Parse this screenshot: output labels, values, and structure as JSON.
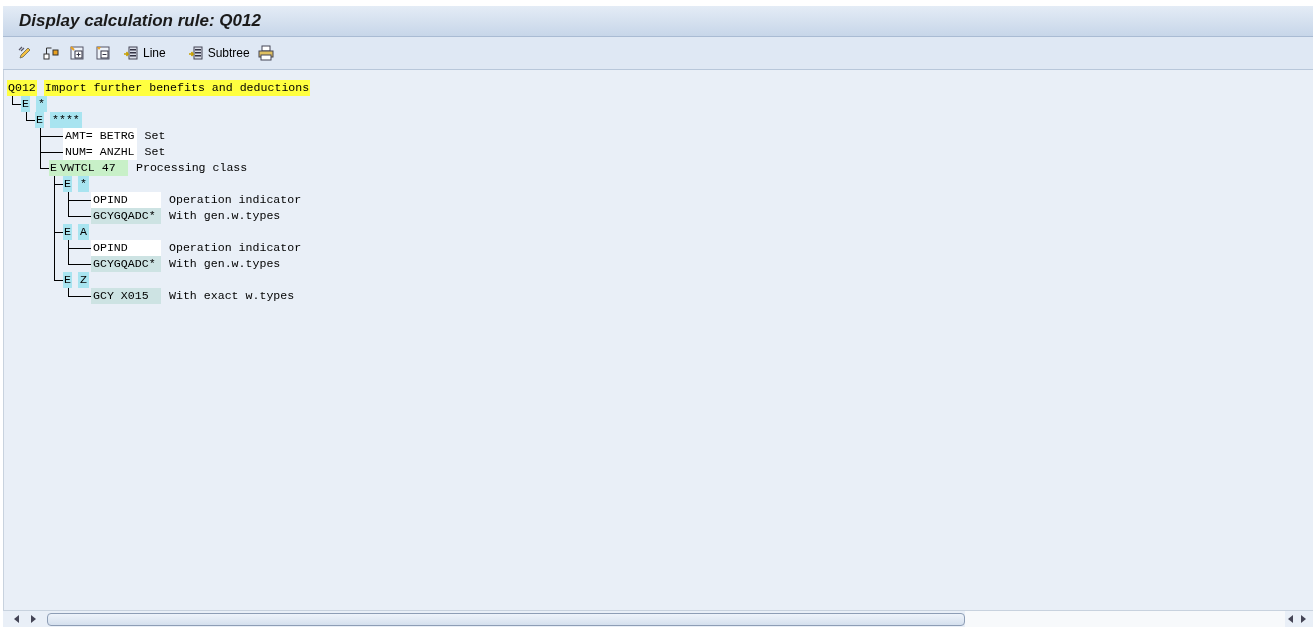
{
  "title": "Display calculation rule: Q012",
  "toolbar": [
    {
      "label": "Line"
    },
    {
      "label": "Subtree"
    }
  ],
  "tree": {
    "code": "Q012",
    "text": "Import further benefits and deductions",
    "children": [
      {
        "kind": "event",
        "marker": "E",
        "code": "*",
        "children": [
          {
            "kind": "event",
            "marker": "E",
            "code": "****",
            "children": [
              {
                "kind": "operation",
                "code": "AMT= BETRG",
                "text": "Set"
              },
              {
                "kind": "operation",
                "code": "NUM= ANZHL",
                "text": "Set"
              },
              {
                "kind": "class",
                "marker": "E",
                "code": "VWTCL 47",
                "text": "Processing class",
                "children": [
                  {
                    "kind": "event",
                    "marker": "E",
                    "code": "*",
                    "children": [
                      {
                        "kind": "operation",
                        "code": "OPIND",
                        "text": "Operation indicator"
                      },
                      {
                        "kind": "wage_type",
                        "code": "GCYGQADC*",
                        "text": "With gen.w.types"
                      }
                    ]
                  },
                  {
                    "kind": "event",
                    "marker": "E",
                    "code": "A",
                    "children": [
                      {
                        "kind": "operation",
                        "code": "OPIND",
                        "text": "Operation indicator"
                      },
                      {
                        "kind": "wage_type",
                        "code": "GCYGQADC*",
                        "text": "With gen.w.types"
                      }
                    ]
                  },
                  {
                    "kind": "event",
                    "marker": "E",
                    "code": "Z",
                    "children": [
                      {
                        "kind": "wage_type",
                        "code": "GCY X015",
                        "text": "With exact w.types"
                      }
                    ]
                  }
                ]
              }
            ]
          }
        ]
      }
    ]
  }
}
